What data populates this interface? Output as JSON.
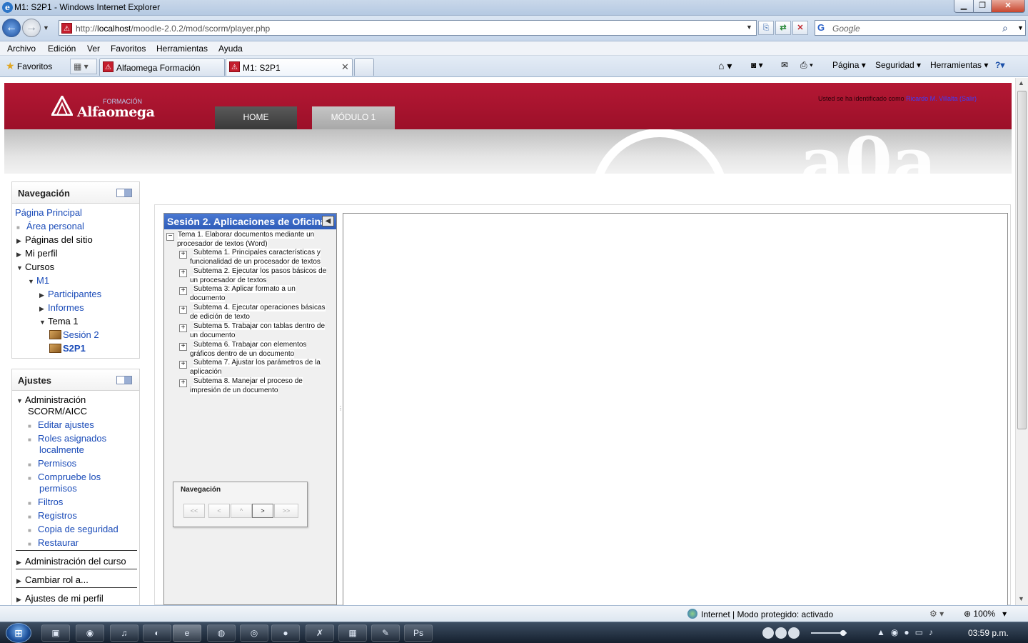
{
  "window": {
    "title": "M1: S2P1 - Windows Internet Explorer",
    "url_prefix": "http://",
    "url_host": "localhost",
    "url_path": "/moodle-2.0.2/mod/scorm/player.php",
    "search_placeholder": "Google"
  },
  "menu": [
    "Archivo",
    "Edición",
    "Ver",
    "Favoritos",
    "Herramientas",
    "Ayuda"
  ],
  "favorites_label": "Favoritos",
  "tabs": [
    {
      "label": "Alfaomega Formación"
    },
    {
      "label": "M1: S2P1"
    }
  ],
  "command_bar": {
    "page": "Página",
    "security": "Seguridad",
    "tools": "Herramientas"
  },
  "site": {
    "logo_text": "Alfaomega",
    "logo_sub": "FORMACIÓN",
    "login_prefix": "Usted se ha identificado como",
    "user_name": "Ricardo M. Villalta",
    "logout": "(Salir)",
    "nav": [
      "HOME",
      "MÓDULO   1"
    ]
  },
  "nav_block": {
    "title": "Navegación",
    "items": [
      {
        "label": "Página Principal"
      },
      {
        "label": "Área personal"
      },
      {
        "label": "Páginas del sitio"
      },
      {
        "label": "Mi perfil"
      },
      {
        "label": "Cursos"
      },
      {
        "label": "M1"
      },
      {
        "label": "Participantes"
      },
      {
        "label": "Informes"
      },
      {
        "label": "Tema 1"
      },
      {
        "label": "Sesión 2"
      },
      {
        "label": "S2P1"
      }
    ]
  },
  "settings_block": {
    "title": "Ajustes",
    "items": [
      {
        "label": "Administración"
      },
      {
        "label": "SCORM/AICC"
      },
      {
        "label": "Editar ajustes"
      },
      {
        "label": "Roles asignados"
      },
      {
        "label": "localmente"
      },
      {
        "label": "Permisos"
      },
      {
        "label": "Compruebe los"
      },
      {
        "label": "permisos"
      },
      {
        "label": "Filtros"
      },
      {
        "label": "Registros"
      },
      {
        "label": "Copia de seguridad"
      },
      {
        "label": "Restaurar"
      },
      {
        "label": "Administración del curso"
      },
      {
        "label": "Cambiar rol a..."
      },
      {
        "label": "Ajustes de mi perfil"
      }
    ]
  },
  "toc": {
    "title": "Sesión 2. Aplicaciones de Oficina",
    "tema": [
      "Tema 1. Elaborar documentos mediante un",
      "procesador de textos (Word)"
    ],
    "subtemas": [
      [
        "Subtema 1. Principales características y",
        "funcionalidad de un procesador de textos"
      ],
      [
        "Subtema 2. Ejecutar los pasos básicos de",
        "un procesador de textos"
      ],
      [
        "Subtema 3: Aplicar formato a un",
        "documento"
      ],
      [
        "Subtema 4. Ejecutar operaciones básicas",
        "de edición de texto"
      ],
      [
        "Subtema 5. Trabajar con tablas dentro de",
        "un documento"
      ],
      [
        "Subtema 6. Trabajar con elementos",
        "gráficos dentro de un documento"
      ],
      [
        "Subtema 7. Ajustar los parámetros de la",
        "aplicación"
      ],
      [
        "Subtema 8. Manejar el proceso de",
        "impresión de un documento"
      ]
    ]
  },
  "scorm_nav": {
    "title": "Navegación",
    "buttons": [
      "<<",
      "<",
      "^",
      ">",
      ">>"
    ]
  },
  "status": {
    "zone": "Internet | Modo protegido: activado",
    "zoom": "100%"
  },
  "taskbar": {
    "clock": "03:59 p.m."
  }
}
